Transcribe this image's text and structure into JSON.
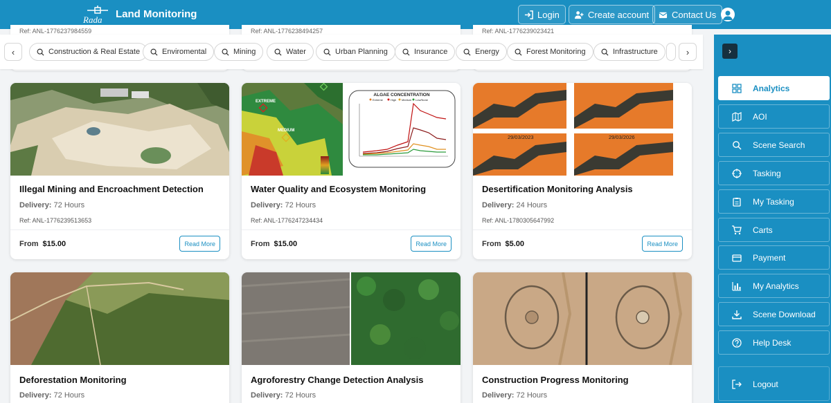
{
  "header": {
    "logo_text": "Rada",
    "brand": "Land Monitoring",
    "login": "Login",
    "create_account": "Create account",
    "contact_us": "Contact Us"
  },
  "categories": [
    "Construction & Real Estate",
    "Enviromental",
    "Mining",
    "Water",
    "Urban Planning",
    "Insurance",
    "Energy",
    "Forest Monitoring",
    "Infrastructure"
  ],
  "partial_refs": [
    "Ref: ANL-1776237984559",
    "Ref: ANL-1776238494257",
    "Ref: ANL-1776239023421"
  ],
  "cards": [
    {
      "title": "Illegal Mining and Encroachment Detection",
      "delivery_label": "Delivery:",
      "delivery": "72 Hours",
      "ref": "Ref: ANL-1776239513653",
      "from": "From",
      "price": "$15.00",
      "button": "Read More"
    },
    {
      "title": "Water Quality and Ecosystem Monitoring",
      "delivery_label": "Delivery:",
      "delivery": "72 Hours",
      "ref": "Ref: ANL-1776247234434",
      "from": "From",
      "price": "$15.00",
      "button": "Read More"
    },
    {
      "title": "Desertification Monitoring Analysis",
      "delivery_label": "Delivery:",
      "delivery": "24 Hours",
      "ref": "Ref: ANL-1780305647992",
      "from": "From",
      "price": "$5.00",
      "button": "Read More"
    },
    {
      "title": "Deforestation Monitoring",
      "delivery_label": "Delivery:",
      "delivery": "72 Hours"
    },
    {
      "title": "Agroforestry Change Detection Analysis",
      "delivery_label": "Delivery:",
      "delivery": "72 Hours"
    },
    {
      "title": "Construction Progress Monitoring",
      "delivery_label": "Delivery:",
      "delivery": "72 Hours"
    }
  ],
  "chart_card": {
    "title": "ALGAE CONCENTRATION",
    "legend": [
      "Extreme",
      "High",
      "Medium",
      "Low/None"
    ],
    "map_labels": [
      "EXTREME",
      "MEDIUM"
    ]
  },
  "desert_dates": [
    "29/03/2023",
    "29/03/2026"
  ],
  "sidebar": {
    "items": [
      "Analytics",
      "AOI",
      "Scene Search",
      "Tasking",
      "My Tasking",
      "Carts",
      "Payment",
      "My Analytics",
      "Scene Download",
      "Help Desk",
      "Logout"
    ]
  },
  "colors": {
    "primary": "#1a8fc2",
    "active_bg": "#ffffff"
  }
}
